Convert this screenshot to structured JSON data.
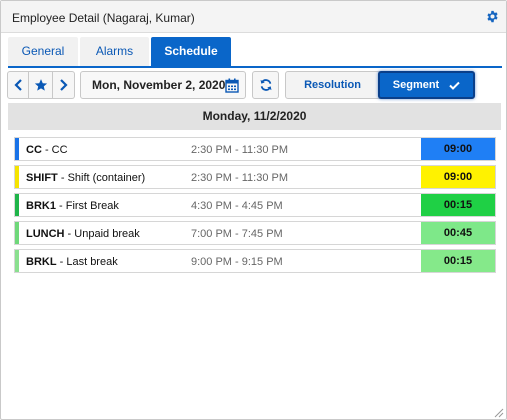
{
  "window": {
    "title": "Employee Detail (Nagaraj, Kumar)"
  },
  "tabs": [
    {
      "label": "General",
      "active": false
    },
    {
      "label": "Alarms",
      "active": false
    },
    {
      "label": "Schedule",
      "active": true
    }
  ],
  "toolbar": {
    "prev_icon": "chevron-left-icon",
    "favorite_icon": "star-icon",
    "next_icon": "chevron-right-icon",
    "date_value": "Mon, November 2, 2020",
    "calendar_icon": "calendar-icon",
    "refresh_icon": "refresh-icon",
    "resolution_label": "Resolution",
    "segment_label": "Segment",
    "segment_selected": true,
    "check_icon": "check-icon"
  },
  "day_header": "Monday, 11/2/2020",
  "segments": [
    {
      "code": "CC",
      "separator": " - ",
      "description": "CC",
      "time": "2:30 PM - 11:30 PM",
      "duration": "09:00",
      "bar_color": "#1a73e8",
      "duration_color": "#1f7ff5"
    },
    {
      "code": "SHIFT",
      "separator": " - ",
      "description": "Shift (container)",
      "time": "2:30 PM - 11:30 PM",
      "duration": "09:00",
      "bar_color": "#f5e400",
      "duration_color": "#fff200"
    },
    {
      "code": "BRK1",
      "separator": " - ",
      "description": "First Break",
      "time": "4:30 PM - 4:45 PM",
      "duration": "00:15",
      "bar_color": "#1fb54a",
      "duration_color": "#1fd045"
    },
    {
      "code": "LUNCH",
      "separator": " - ",
      "description": "Unpaid break",
      "time": "7:00 PM - 7:45 PM",
      "duration": "00:45",
      "bar_color": "#6fd87a",
      "duration_color": "#7ee889"
    },
    {
      "code": "BRKL",
      "separator": " - ",
      "description": "Last break",
      "time": "9:00 PM - 9:15 PM",
      "duration": "00:15",
      "bar_color": "#8ae08f",
      "duration_color": "#85e98a"
    }
  ],
  "colors": {
    "accent": "#0a66c9",
    "tab_text": "#0a58b5"
  }
}
